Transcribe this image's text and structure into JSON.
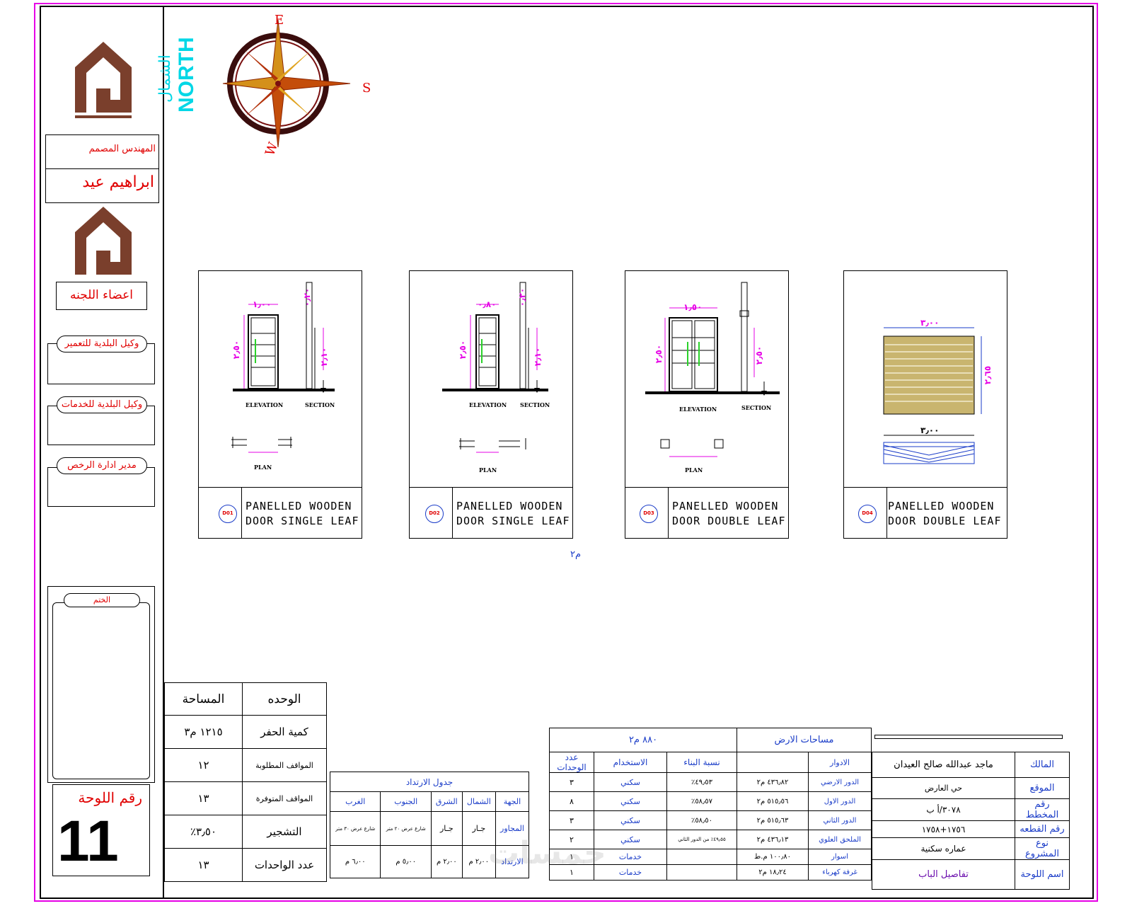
{
  "title_block_left": {
    "designer_label": "المهندس المصمم",
    "designer_name": "ابراهيم عيد",
    "committee_label": "اعضاء اللجنه",
    "sig1_label": "وكيل البلدية للتعمير",
    "sig2_label": "وكيل البلدية للخدمات",
    "sig3_label": "مدير ادارة الرخص",
    "stamp_label": "الختم",
    "sheet_no_label": "رقم اللوحة",
    "sheet_no": "11"
  },
  "compass": {
    "north_ar": "الشمال",
    "north_en": "NORTH",
    "e": "E",
    "s": "S",
    "w": "W"
  },
  "doors": [
    {
      "text1": "PANELLED WOODEN",
      "text2": "DOOR SINGLE LEAF",
      "badge": "D01",
      "elev": "ELEVATION",
      "sect": "SECTION",
      "plan": "PLAN",
      "w": "١٫٠٠",
      "h": "٢٫٥٠",
      "h2": "٢٫١٠",
      "t": "٠٫٢٠"
    },
    {
      "text1": "PANELLED WOODEN",
      "text2": "DOOR SINGLE LEAF",
      "badge": "D02",
      "elev": "ELEVATION",
      "sect": "SECTION",
      "plan": "PLAN",
      "w": "٠٫٨٠",
      "h": "٢٫٥٠",
      "h2": "٢٫١٠",
      "t": "٠٫٢٠"
    },
    {
      "text1": "PANELLED WOODEN",
      "text2": "DOOR DOUBLE LEAF",
      "badge": "D03",
      "elev": "ELEVATION",
      "sect": "SECTION",
      "plan": "PLAN",
      "w": "١٫٥٠",
      "h": "٢٫٥٠",
      "h2": "٢٫٥٠",
      "t": ""
    },
    {
      "text1": "PANELLED WOODEN",
      "text2": "DOOR DOUBLE LEAF",
      "badge": "D04",
      "w": "٣٫٠٠",
      "h": "٢٫٦٥",
      "w2": "٣٫٠٠"
    }
  ],
  "unit_label_mid": "م٢",
  "summary_table": {
    "h_unit": "الوحده",
    "h_area": "المساحة",
    "rows": [
      {
        "k": "كمية الحفر",
        "v": "١٢١٥ م٣"
      },
      {
        "k": "المواقف المطلوبة",
        "v": "١٢"
      },
      {
        "k": "المواقف المتوفرة",
        "v": "١٣"
      },
      {
        "k": "التشجير",
        "v": "٣٫٥٠٪"
      },
      {
        "k": "عدد الواحدات",
        "v": "١٣"
      }
    ]
  },
  "setback_table": {
    "title": "جدول الارتداد",
    "headers": [
      "الجهة",
      "الشمال",
      "الشرق",
      "الجنوب",
      "الغرب"
    ],
    "row1": [
      "المجاور",
      "جـار",
      "جـار",
      "شارع عرض ٢٠ متر",
      "شارع عرض ٣٠ متر"
    ],
    "row2": [
      "الارتداد",
      "٢٫٠٠ م",
      "٢٫٠٠ م",
      "٥٫٠٠ م",
      "٦٫٠٠ م"
    ]
  },
  "areas_table": {
    "title": "مساحات الارض",
    "total": "٨٨٠ م٢",
    "headers": [
      "الادوار",
      "",
      "نسبة البناء",
      "الاستخدام",
      "عدد الوحدات"
    ],
    "rows": [
      [
        "الدور الارضي",
        "٤٣٦٫٨٢ م٢",
        "٤٩٫٥٣٪",
        "سكني",
        "٣"
      ],
      [
        "الدور الاول",
        "٥١٥٫٥٦ م٢",
        "٥٨٫٥٧٪",
        "سكني",
        "٨"
      ],
      [
        "الدور الثاني",
        "٥١٥٫٦٣ م٢",
        "٥٨٫٥٠٪",
        "سكني",
        "٣"
      ],
      [
        "الملحق العلوي",
        "٤٣٦٫١٣ م٢",
        "٤٩٫٥٥٪ من الدور الثاني",
        "سكني",
        "٢"
      ],
      [
        "اسوار",
        "١٠٠٫٨٠ م.ط",
        "",
        "خدمات",
        "١"
      ],
      [
        "غرفة كهرباء",
        "١٨٫٢٤ م٢",
        "",
        "خدمات",
        "١"
      ]
    ]
  },
  "project_info": {
    "owner_label": "المالك",
    "owner": "ماجد عبدالله صالح العيدان",
    "location_label": "الموقع",
    "location": "حي العارض",
    "plan_no_label": "رقم المخطط",
    "plan_no": "٣٠٧٨/أ ب",
    "plot_no_label": "رقم القطعه",
    "plot_no": "١٧٥٦+١٧٥٨",
    "project_type_label": "نوع المشروع",
    "project_type": "عماره سكنية",
    "sheet_name_label": "اسم اللوحة",
    "sheet_name": "تفاصيل الباب"
  },
  "watermark": "خمسات"
}
